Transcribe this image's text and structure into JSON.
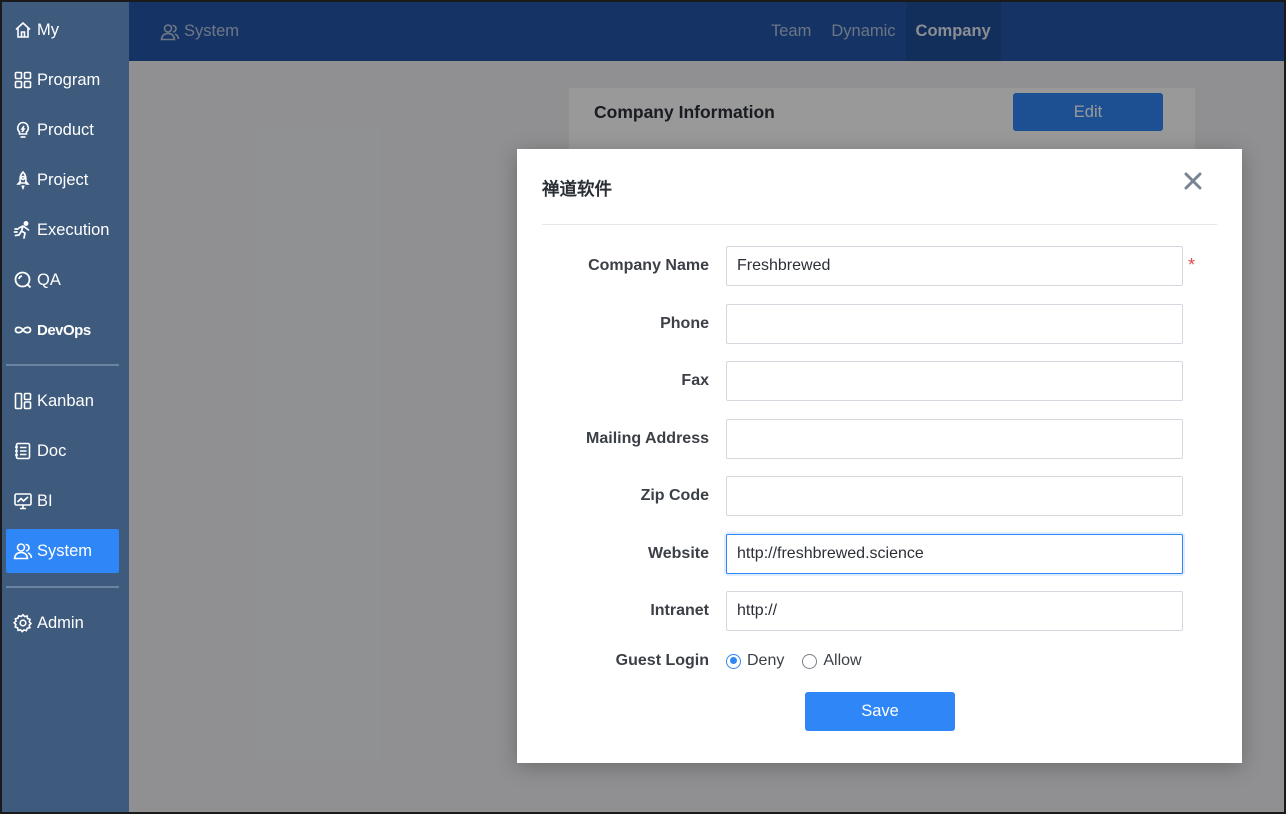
{
  "sidebar": {
    "items": [
      {
        "label": "My",
        "icon": "home-icon"
      },
      {
        "label": "Program",
        "icon": "grid-icon"
      },
      {
        "label": "Product",
        "icon": "lightbulb-icon"
      },
      {
        "label": "Project",
        "icon": "rocket-icon"
      },
      {
        "label": "Execution",
        "icon": "running-icon"
      },
      {
        "label": "QA",
        "icon": "magnifier-icon"
      },
      {
        "label": "DevOps",
        "icon": "infinity-icon"
      },
      {
        "label": "Kanban",
        "icon": "kanban-icon"
      },
      {
        "label": "Doc",
        "icon": "document-icon"
      },
      {
        "label": "BI",
        "icon": "chart-monitor-icon"
      },
      {
        "label": "System",
        "icon": "users-icon",
        "active": true
      },
      {
        "label": "Admin",
        "icon": "gear-icon"
      }
    ]
  },
  "header": {
    "breadcrumb": "System",
    "tabs": [
      {
        "label": "Team"
      },
      {
        "label": "Dynamic"
      },
      {
        "label": "Company",
        "active": true
      }
    ]
  },
  "main": {
    "card_title": "Company Information",
    "edit_label": "Edit"
  },
  "modal": {
    "title": "禅道软件",
    "fields": {
      "company_name": {
        "label": "Company Name",
        "value": "Freshbrewed",
        "required": true
      },
      "phone": {
        "label": "Phone",
        "value": ""
      },
      "fax": {
        "label": "Fax",
        "value": ""
      },
      "address": {
        "label": "Mailing Address",
        "value": ""
      },
      "zip": {
        "label": "Zip Code",
        "value": ""
      },
      "website": {
        "label": "Website",
        "value": "http://freshbrewed.science"
      },
      "intranet": {
        "label": "Intranet",
        "value": "http://"
      }
    },
    "guest_login": {
      "label": "Guest Login",
      "options": [
        "Deny",
        "Allow"
      ],
      "selected": "Deny"
    },
    "required_mark": "*",
    "save_label": "Save"
  },
  "colors": {
    "sidebar_bg": "#3e5a7d",
    "header_bg": "#2357a8",
    "accent": "#2f86f6",
    "required": "#e34b4b"
  }
}
